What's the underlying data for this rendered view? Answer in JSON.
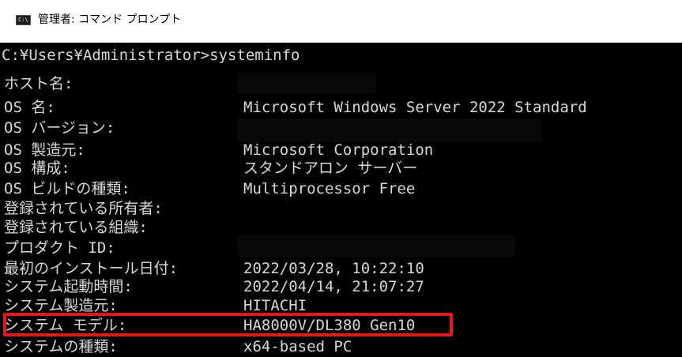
{
  "window": {
    "title": "管理者: コマンド プロンプト",
    "icon": "cmd-icon"
  },
  "console": {
    "prompt": "C:¥Users¥Administrator>systeminfo",
    "rows": [
      {
        "label": "ホスト名:",
        "value": ""
      },
      {
        "label": "OS 名:",
        "value": "Microsoft Windows Server 2022 Standard"
      },
      {
        "label": "OS バージョン:",
        "value": ""
      },
      {
        "label": "OS 製造元:",
        "value": "Microsoft Corporation"
      },
      {
        "label": "OS 構成:",
        "value": "スタンドアロン サーバー"
      },
      {
        "label": "OS ビルドの種類:",
        "value": "Multiprocessor Free"
      },
      {
        "label": "登録されている所有者:",
        "value": ""
      },
      {
        "label": "登録されている組織:",
        "value": ""
      },
      {
        "label": "プロダクト ID:",
        "value": ""
      },
      {
        "label": "最初のインストール日付:",
        "value": "2022/03/28, 10:22:10"
      },
      {
        "label": "システム起動時間:",
        "value": "2022/04/14, 21:07:27"
      },
      {
        "label": "システム製造元:",
        "value": "HITACHI"
      },
      {
        "label": "システム モデル:",
        "value": "HA8000V/DL380 Gen10"
      },
      {
        "label": "システムの種類:",
        "value": "x64-based PC"
      }
    ]
  },
  "colors": {
    "background": "#000000",
    "text": "#d8d8d8",
    "highlight": "#e8161b"
  }
}
